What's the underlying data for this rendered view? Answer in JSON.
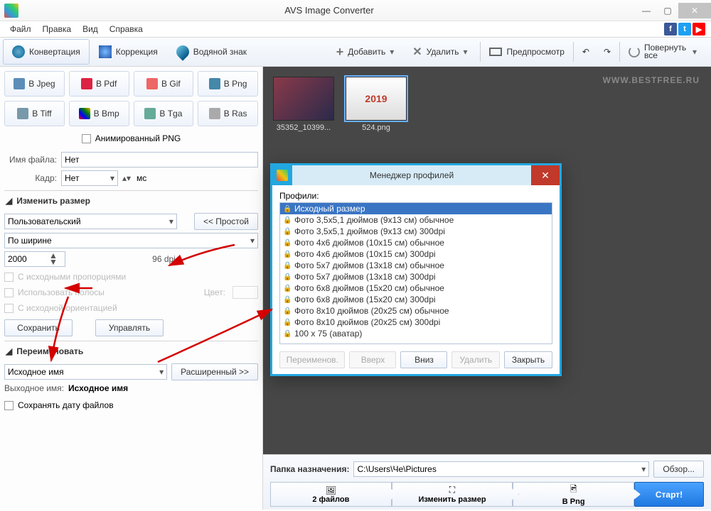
{
  "window": {
    "title": "AVS Image Converter"
  },
  "menu": {
    "file": "Файл",
    "edit": "Правка",
    "view": "Вид",
    "help": "Справка"
  },
  "tabs": {
    "convert": "Конвертация",
    "correct": "Коррекция",
    "watermark": "Водяной знак"
  },
  "toolbar": {
    "add": "Добавить",
    "delete": "Удалить",
    "preview": "Предпросмотр",
    "rotate": "Повернуть все"
  },
  "formats": {
    "jpeg": "В Jpeg",
    "pdf": "В Pdf",
    "gif": "В Gif",
    "png": "В Png",
    "tiff": "В Tiff",
    "bmp": "В Bmp",
    "tga": "В Tga",
    "ras": "В Ras"
  },
  "animated": "Анимированный PNG",
  "filename_label": "Имя файла:",
  "filename_value": "Нет",
  "frame_label": "Кадр:",
  "frame_value": "Нет",
  "frame_unit": "мс",
  "resize": {
    "heading": "Изменить размер",
    "mode": "Пользовательский",
    "simple": "<< Простой",
    "by": "По ширине",
    "value": "2000",
    "dpi": "96 dpi",
    "keep_aspect": "С исходными пропорциями",
    "use_bars": "Использовать полосы",
    "color_label": "Цвет:",
    "keep_orient": "С исходной ориентацией",
    "save": "Сохранить",
    "manage": "Управлять"
  },
  "rename": {
    "heading": "Переименовать",
    "preset": "Исходное имя",
    "advanced": "Расширенный >>",
    "outname_label": "Выходное имя:",
    "outname_value": "Исходное имя"
  },
  "keep_date": "Сохранять дату файлов",
  "thumbs": [
    {
      "name": "35352_10399..."
    },
    {
      "name": "524.png"
    }
  ],
  "watermark_text": "WWW.BESTFREE.RU",
  "dest": {
    "label": "Папка назначения:",
    "value": "C:\\Users\\Че\\Pictures",
    "browse": "Обзор..."
  },
  "steps": {
    "files": "2 файлов",
    "resize": "Изменить размер",
    "fmt": "В Png",
    "start": "Старт!"
  },
  "dialog": {
    "title": "Менеджер профилей",
    "list_label": "Профили:",
    "items": [
      "Исходный размер",
      "Фото 3,5x5,1 дюймов (9x13 см) обычное",
      "Фото 3,5x5,1 дюймов (9x13 см) 300dpi",
      "Фото 4x6 дюймов (10x15 см) обычное",
      "Фото 4x6 дюймов (10x15 см) 300dpi",
      "Фото 5x7 дюймов (13x18 см) обычное",
      "Фото 5x7 дюймов (13x18 см) 300dpi",
      "Фото 6x8 дюймов (15x20 см) обычное",
      "Фото 6x8 дюймов (15x20 см) 300dpi",
      "Фото 8x10 дюймов (20x25 см) обычное",
      "Фото 8x10 дюймов (20x25 см) 300dpi",
      "100 x 75 (аватар)"
    ],
    "rename": "Переименов.",
    "up": "Вверх",
    "down": "Вниз",
    "delete": "Удалить",
    "close": "Закрыть"
  }
}
